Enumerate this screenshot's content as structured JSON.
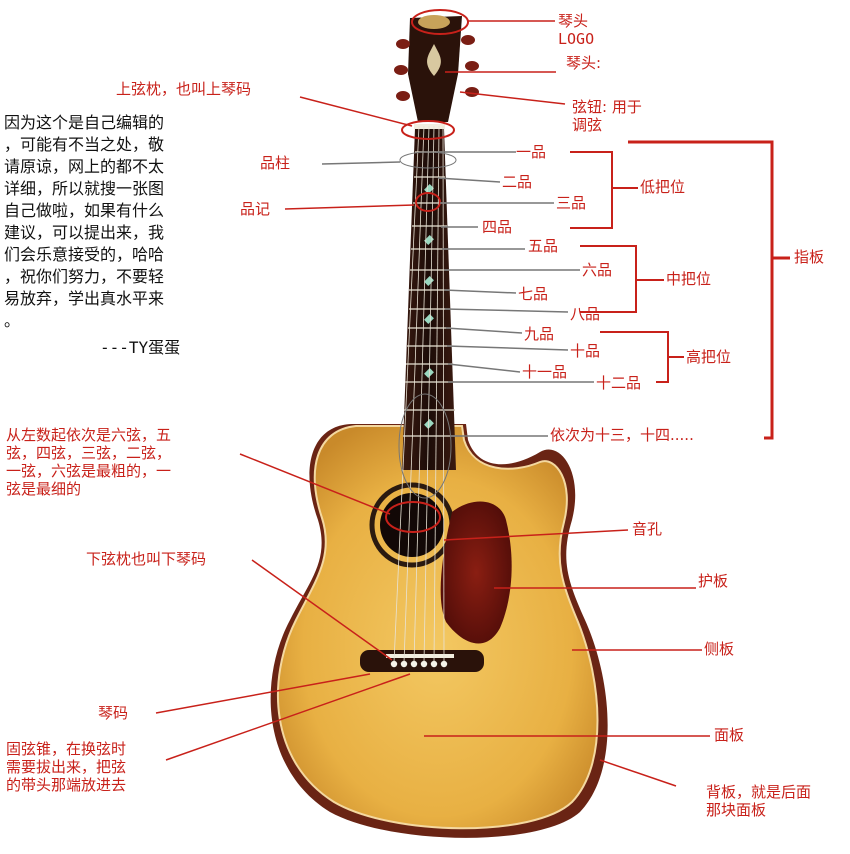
{
  "colors": {
    "label": "#c8211a",
    "body": "#e8b64a",
    "wood_edge": "#7a2e1c",
    "guard": "#6e1410",
    "neck": "#2a1410"
  },
  "note": {
    "text": "因为这个是自己编辑的\n，可能有不当之处，敬\n请原谅，网上的都不太\n详细，所以就搜一张图\n自己做啦，如果有什么\n建议，可以提出来，我\n们会乐意接受的，哈哈\n，祝你们努力，不要轻\n易放弃，学出真水平来\n。",
    "signature": "---TY蛋蛋"
  },
  "labels": {
    "headstock_logo": "琴头\nLOGO",
    "headstock": "琴头:",
    "tuners": "弦钮: 用于\n调弦",
    "nut": "上弦枕，也叫上琴码",
    "frets": "品柱",
    "inlay": "品记",
    "fret1": "一品",
    "fret2": "二品",
    "fret3": "三品",
    "fret4": "四品",
    "low_position": "低把位",
    "fret5": "五品",
    "fret6": "六品",
    "fret7": "七品",
    "fret8": "八品",
    "mid_position": "中把位",
    "fret9": "九品",
    "fret10": "十品",
    "fret11": "十一品",
    "fret12": "十二品",
    "high_position": "高把位",
    "fingerboard": "指板",
    "fret13_14": "依次为十三，十四.....",
    "strings": "从左数起依次是六弦，五\n弦，四弦，三弦，二弦，\n一弦，六弦是最粗的，一\n弦是最细的",
    "soundhole": "音孔",
    "pickguard": "护板",
    "saddle": "下弦枕也叫下琴码",
    "sides": "侧板",
    "bridge": "琴码",
    "bridge_pins": "固弦锥，在换弦时\n需要拔出来，把弦\n的带头那端放进去",
    "top": "面板",
    "back": "背板，就是后面\n那块面板"
  }
}
